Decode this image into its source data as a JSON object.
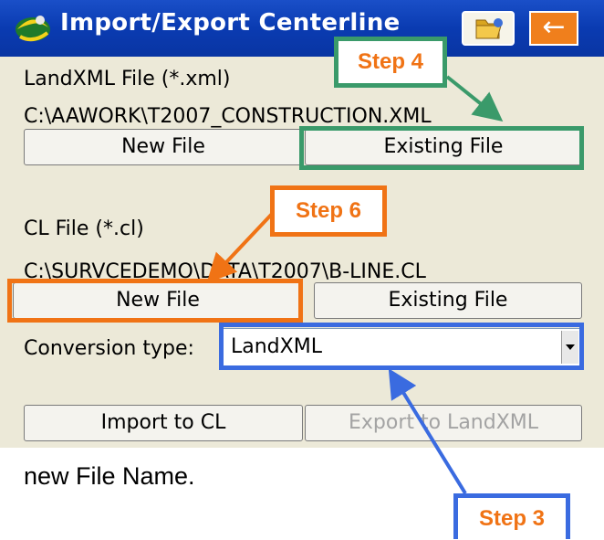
{
  "window": {
    "title": "Import/Export Centerline"
  },
  "landxml": {
    "label": "LandXML File (*.xml)",
    "path": "C:\\AAWORK\\T2007_CONSTRUCTION.XML",
    "new_file_label": "New File",
    "existing_file_label": "Existing File"
  },
  "cl": {
    "label": "CL File (*.cl)",
    "path": "C:\\SURVCEDEMO\\DATA\\T2007\\B-LINE.CL",
    "new_file_label": "New File",
    "existing_file_label": "Existing File"
  },
  "conversion": {
    "label": "Conversion type:",
    "value": "LandXML"
  },
  "actions": {
    "import_label": "Import to CL",
    "export_label": "Export to LandXML"
  },
  "caption": "new File Name.",
  "callouts": {
    "step4": "Step 4",
    "step6": "Step 6",
    "step3": "Step 3"
  },
  "colors": {
    "step4": "#3a9a6a",
    "step6": "#f07315",
    "step3": "#3a6be0",
    "titlebar": "#0a3bb1"
  }
}
